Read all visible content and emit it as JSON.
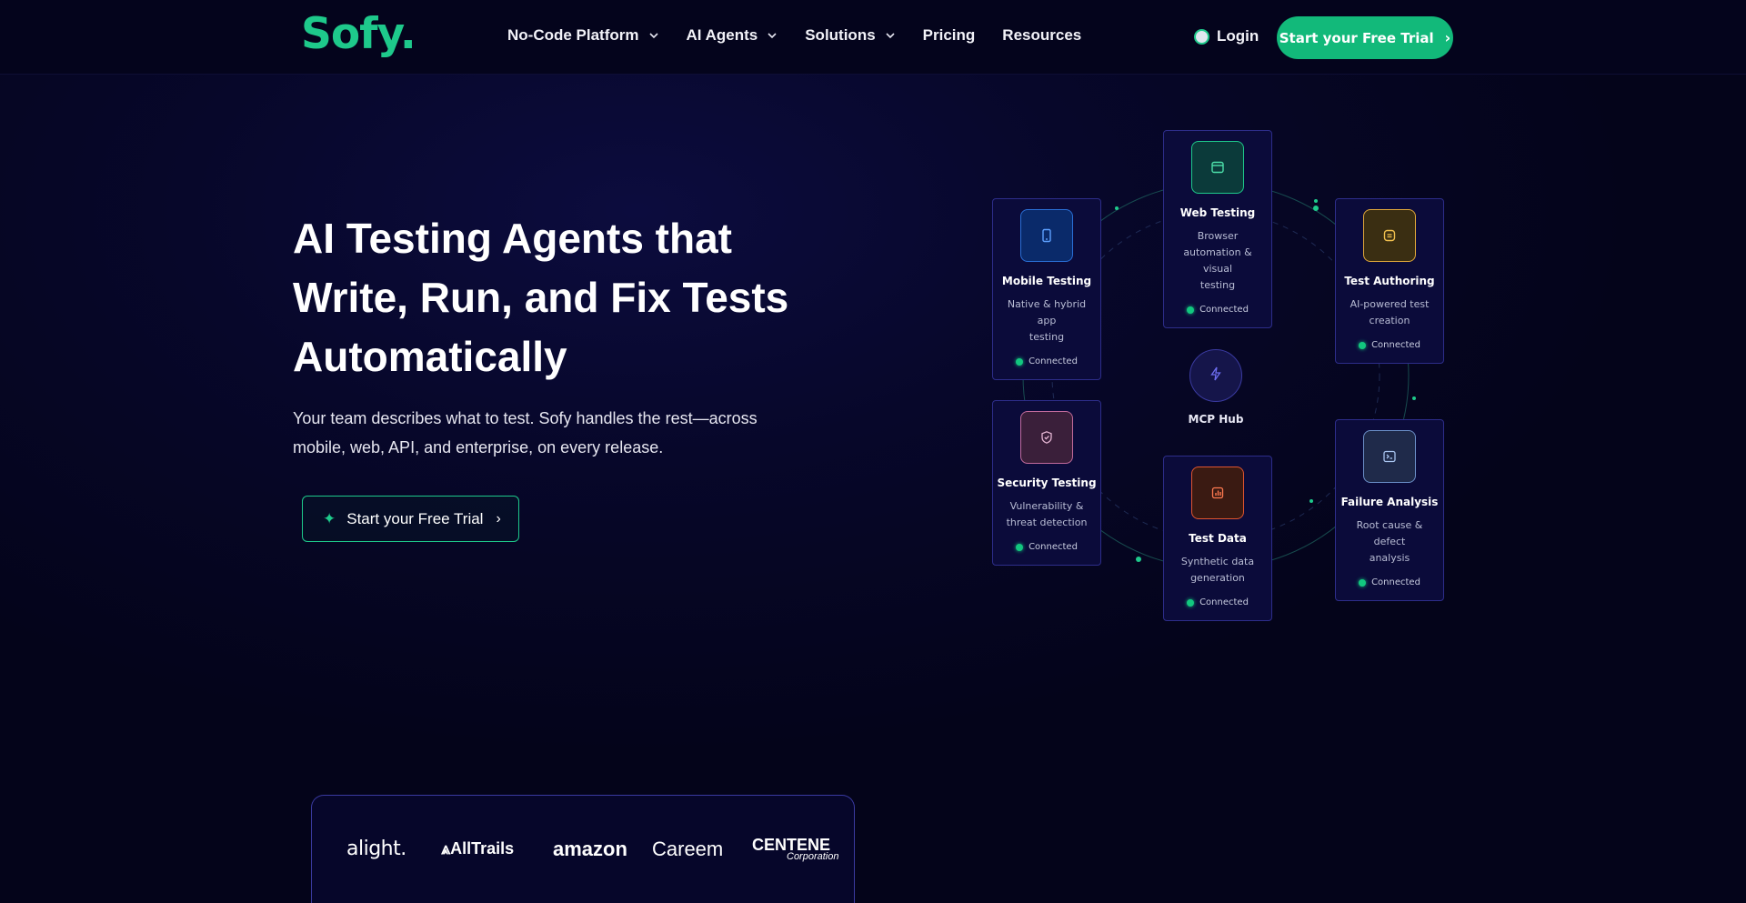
{
  "nav": {
    "logo": "Sofy.",
    "links": [
      {
        "label": "No-Code Platform",
        "dropdown": true
      },
      {
        "label": "AI Agents",
        "dropdown": true
      },
      {
        "label": "Solutions",
        "dropdown": true
      },
      {
        "label": "Pricing",
        "dropdown": false
      },
      {
        "label": "Resources",
        "dropdown": false
      }
    ],
    "login": "Login",
    "cta": "Start your Free Trial"
  },
  "hero": {
    "title_lines": [
      "AI Testing Agents that",
      "Write, Run, and Fix Tests",
      "Automatically"
    ],
    "subtitle_lines": [
      "Your team describes what to test. Sofy handles the rest—across",
      "mobile, web, API, and enterprise, on every release."
    ],
    "cta": "Start your Free Trial"
  },
  "diagram": {
    "hub": "MCP Hub",
    "cards": [
      {
        "title": "Mobile Testing",
        "desc": [
          "Native & hybrid app",
          "testing"
        ],
        "status": "Connected",
        "icon": "mobile-icon",
        "accent": "#2a6fd6"
      },
      {
        "title": "Web Testing",
        "desc": [
          "Browser",
          "automation & visual",
          "testing"
        ],
        "status": "Connected",
        "icon": "browser-icon",
        "accent": "#1ec98b"
      },
      {
        "title": "Test Authoring",
        "desc": [
          "AI-powered test",
          "creation"
        ],
        "status": "Connected",
        "icon": "document-icon",
        "accent": "#e0a83a"
      },
      {
        "title": "Security Testing",
        "desc": [
          "Vulnerability &",
          "threat detection"
        ],
        "status": "Connected",
        "icon": "shield-icon",
        "accent": "#c26b9c"
      },
      {
        "title": "Test Data",
        "desc": [
          "Synthetic data",
          "generation"
        ],
        "status": "Connected",
        "icon": "chart-icon",
        "accent": "#e0552f"
      },
      {
        "title": "Failure Analysis",
        "desc": [
          "Root cause & defect",
          "analysis"
        ],
        "status": "Connected",
        "icon": "terminal-icon",
        "accent": "#6b8fc8"
      }
    ]
  },
  "brands": [
    "alight.",
    "AllTrails",
    "amazon",
    "Careem",
    "CENTENE",
    "Corporation"
  ]
}
